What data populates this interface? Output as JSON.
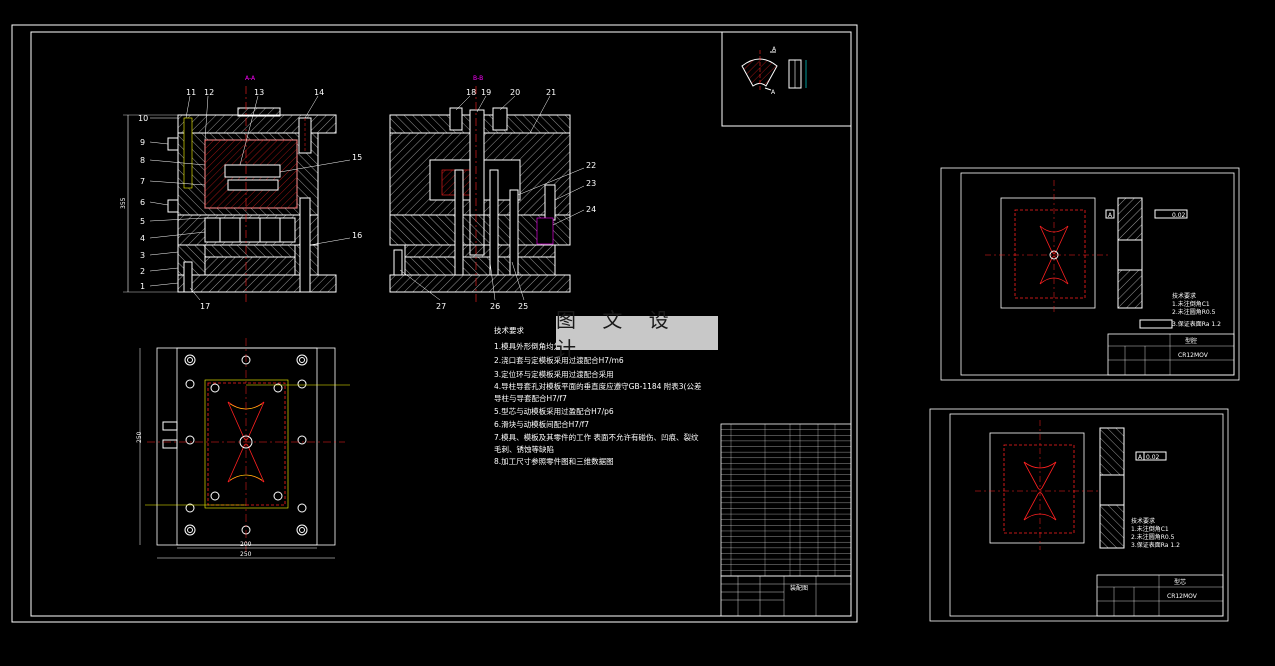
{
  "watermark": "图 文 设 计",
  "main_sheet": {
    "section_labels": {
      "aa": "A-A",
      "bb": "B-B"
    },
    "part_numbers": [
      "1",
      "2",
      "3",
      "4",
      "5",
      "6",
      "7",
      "8",
      "9",
      "10",
      "11",
      "12",
      "13",
      "14",
      "15",
      "16",
      "17",
      "18",
      "19",
      "20",
      "21",
      "22",
      "23",
      "24",
      "25",
      "26",
      "27"
    ],
    "dims": {
      "height": "355",
      "plan_height": "250",
      "plan_width_inner": "200",
      "plan_width_outer": "250"
    },
    "view_a_label": "A",
    "tech_title": "技术要求",
    "tech_lines": [
      "1.模具外形倒角均为C2",
      "2.浇口套与定模板采用过渡配合H7/m6",
      "3.定位环与定模板采用过渡配合采用",
      "4.导柱导套孔对模板平面的垂直度应遵守GB-1184 附表3(公差",
      "  导柱与导套配合H7/f7",
      "5.型芯与动模板采用过盈配合H7/p6",
      "6.滑块与动模板间配合H7/f7",
      "7.模具、模板及其零件的工作 表面不允许有碰伤、凹痕、裂纹",
      "  毛刺、锈蚀等缺陷",
      "8.加工尺寸参照零件图和三维数据图"
    ],
    "title_block_text": "装配图"
  },
  "sheet2": {
    "notes": [
      "技术要求",
      "1.未注倒角C1",
      "2.未注圆角R0.5",
      "3.保证表面Ra 1.2"
    ],
    "material": "CR12MOV",
    "part_name": "型腔",
    "label_a": "A",
    "tol": "0.02"
  },
  "sheet3": {
    "notes": [
      "技术要求",
      "1.未注倒角C1",
      "2.未注圆角R0.5",
      "3.保证表面Ra 1.2"
    ],
    "material": "CR12MOV",
    "part_name": "型芯",
    "label_a": "A",
    "tol": "0.02"
  },
  "colors": {
    "background": "#000000",
    "line": "#ffffff",
    "red": "#ff2020",
    "yellow": "#ffff00",
    "magenta": "#ff00ff"
  }
}
